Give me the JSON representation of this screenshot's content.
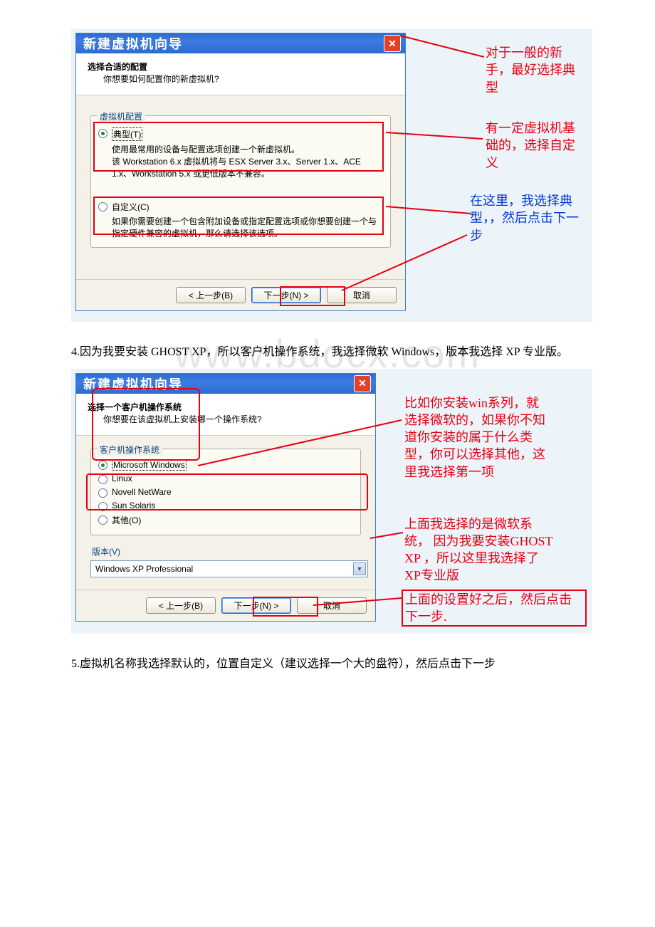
{
  "watermark": "www.bdocx.com",
  "dialog1": {
    "title": "新建虚拟机向导",
    "header_title": "选择合适的配置",
    "header_sub": "你想要如何配置你的新虚拟机?",
    "group_label": "虚拟机配置",
    "radio_typical_label": "典型(T)",
    "radio_typical_desc": "使用最常用的设备与配置选项创建一个新虚拟机。\n该 Workstation 6.x 虚拟机将与 ESX Server 3.x、Server 1.x、ACE 1.x、Workstation 5.x 或更低版本不兼容。",
    "radio_custom_label": "自定义(C)",
    "radio_custom_desc": "如果你需要创建一个包含附加设备或指定配置选项或你想要创建一个与指定硬件兼容的虚拟机，那么请选择该选项。",
    "btn_back": "< 上一步(B)",
    "btn_next": "下一步(N) >",
    "btn_cancel": "取消"
  },
  "ann1": {
    "a": "对于一般的新手，最好选择典型",
    "b": "有一定虚拟机基础的，选择自定义",
    "c": "在这里，我选择典型，，然后点击下一步"
  },
  "paragraph4": "4.因为我要安装 GHOST XP，所以客户机操作系统，我选择微软 Windows，版本我选择 XP 专业版。",
  "dialog2": {
    "title": "新建虚拟机向导",
    "header_title": "选择一个客户机操作系统",
    "header_sub": "你想要在该虚拟机上安装哪一个操作系统?",
    "group_label": "客户机操作系统",
    "os": [
      "Microsoft Windows",
      "Linux",
      "Novell NetWare",
      "Sun Solaris",
      "其他(O)"
    ],
    "version_label": "版本(V)",
    "version_value": "Windows XP Professional",
    "btn_back": "< 上一步(B)",
    "btn_next": "下一步(N) >",
    "btn_cancel": "取消"
  },
  "ann2": {
    "a": "比如你安装win系列，就选择微软的，如果你不知道你安装的属于什么类型，你可以选择其他，这里我选择第一项",
    "b": "上面我选择的是微软系统， 因为我要安装GHOST XP ，所以这里我选择了XP专业版",
    "c": "上面的设置好之后，然后点击下一步."
  },
  "paragraph5": "5.虚拟机名称我选择默认的，位置自定义（建议选择一个大的盘符），然后点击下一步"
}
